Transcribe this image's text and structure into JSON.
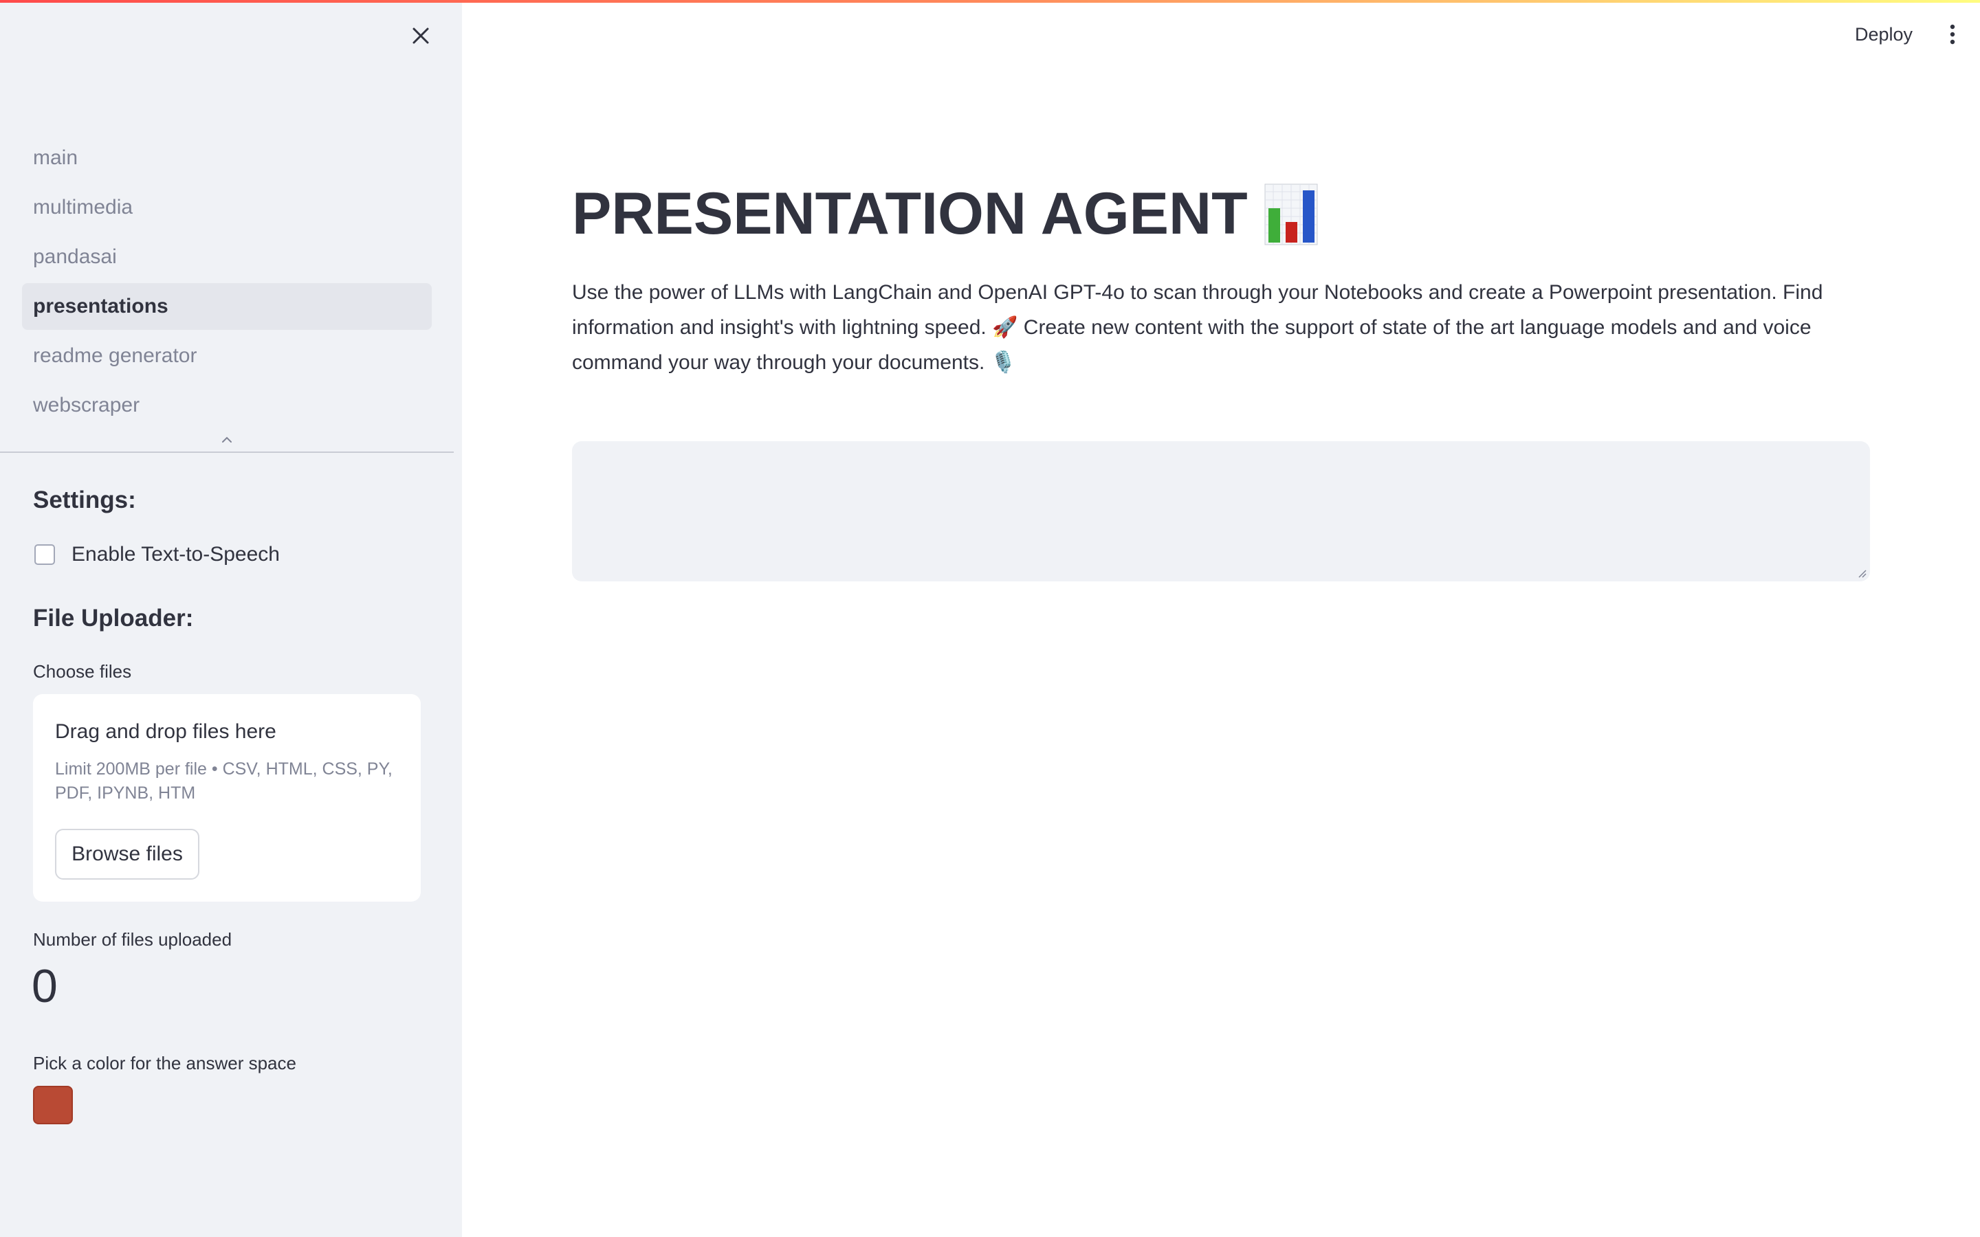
{
  "sidebar": {
    "nav_items": [
      {
        "label": "main",
        "active": false
      },
      {
        "label": "multimedia",
        "active": false
      },
      {
        "label": "pandasai",
        "active": false
      },
      {
        "label": "presentations",
        "active": true
      },
      {
        "label": "readme generator",
        "active": false
      },
      {
        "label": "webscraper",
        "active": false
      }
    ],
    "close_icon": "close-icon",
    "collapse_icon": "chevron-up-icon",
    "settings": {
      "heading": "Settings:",
      "tts_label": "Enable Text-to-Speech",
      "tts_checked": false
    },
    "uploader": {
      "heading": "File Uploader:",
      "choose_label": "Choose files",
      "drop_text": "Drag and drop files here",
      "limit_text": "Limit 200MB per file • CSV, HTML, CSS, PY, PDF, IPYNB, HTM",
      "browse_label": "Browse files"
    },
    "metric": {
      "label": "Number of files uploaded",
      "value": "0"
    },
    "color_picker": {
      "label": "Pick a color for the answer space",
      "value": "#b94a34"
    }
  },
  "header": {
    "deploy_label": "Deploy",
    "menu_icon": "kebab-menu-icon"
  },
  "main": {
    "title": "PRESENTATION AGENT",
    "title_icon": "bar-chart-icon",
    "description": "Use the power of LLMs with LangChain and OpenAI GPT-4o to scan through your Notebooks and create a Powerpoint presentation. Find information and insight's with lightning speed. 🚀 Create new content with the support of state of the art language models and and voice command your way through your documents. 🎙️",
    "answer_value": ""
  },
  "colors": {
    "accent_gradient_start": "#ff4b4b",
    "accent_gradient_end": "#fffd80",
    "sidebar_bg": "#f0f2f6",
    "text": "#31333f"
  }
}
